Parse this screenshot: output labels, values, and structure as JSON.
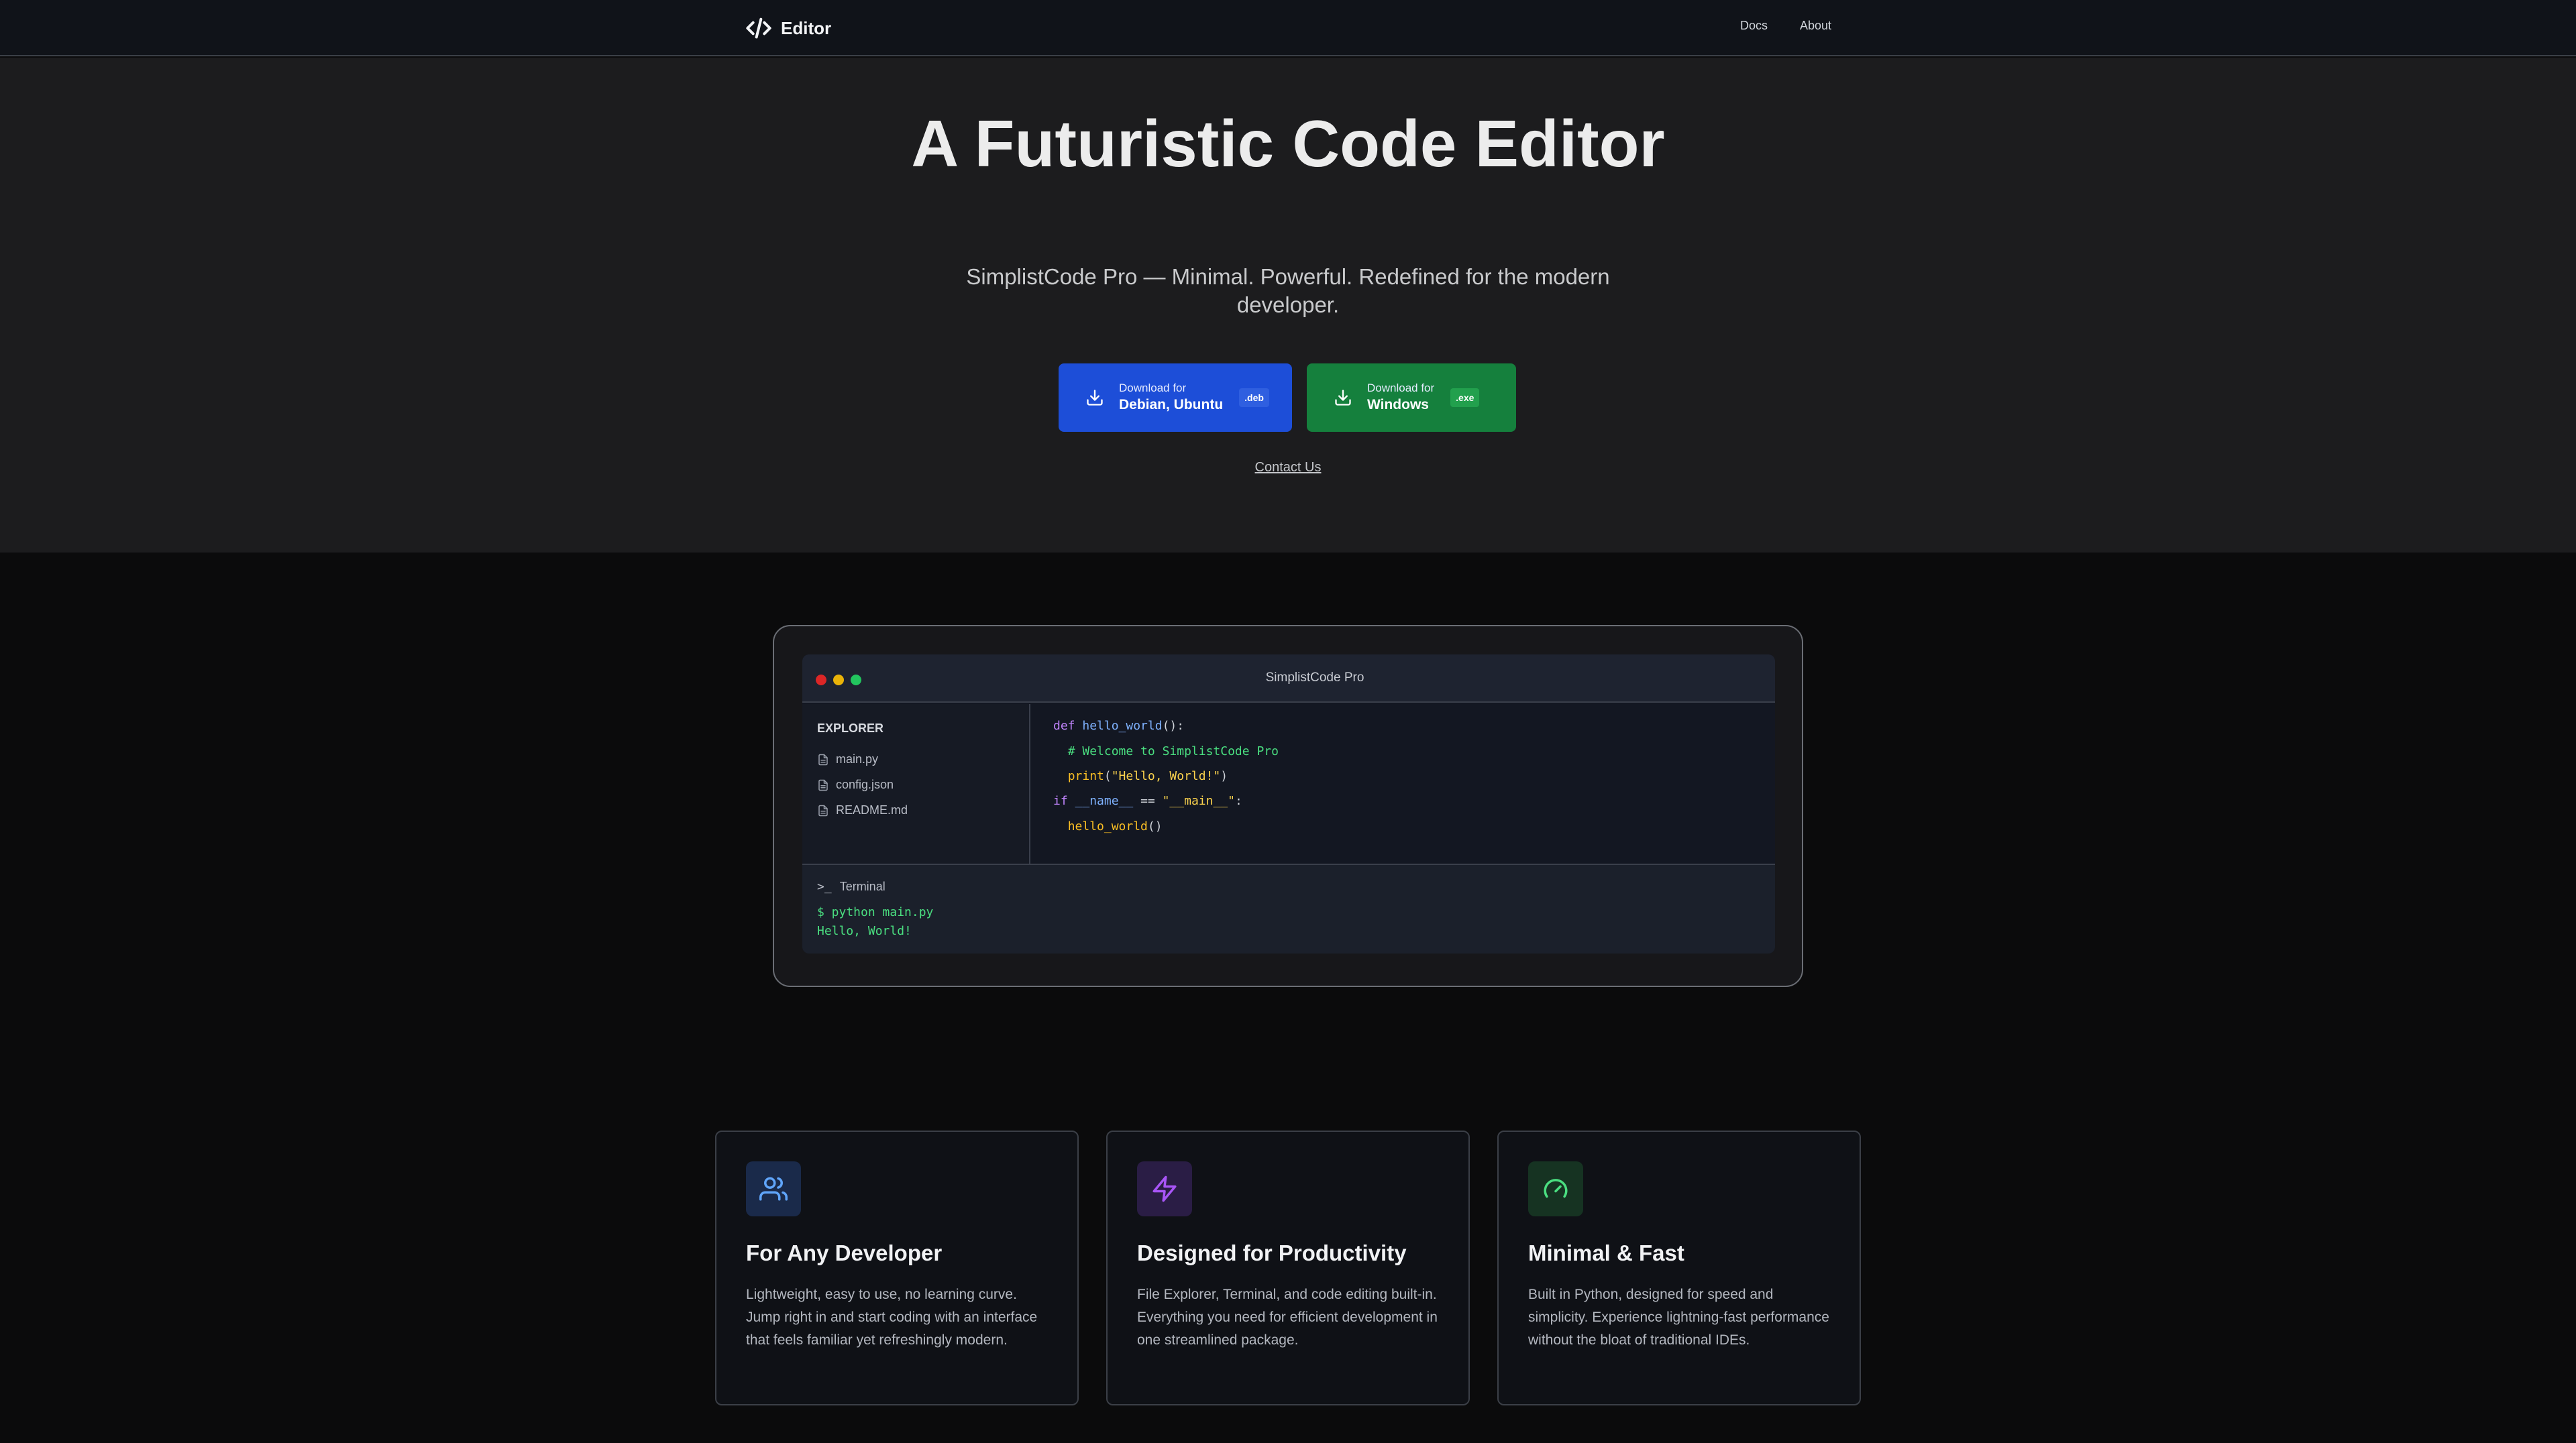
{
  "nav": {
    "brand": "Editor",
    "brand_icon": "code-brackets-icon",
    "links": [
      "Docs",
      "About"
    ]
  },
  "hero": {
    "title": "A Futuristic Code Editor",
    "subtitle": "SimplistCode Pro — Minimal. Powerful. Redefined for the modern developer.",
    "buttons": [
      {
        "small": "Download for",
        "big": "Debian, Ubuntu",
        "badge": ".deb",
        "icon": "download-icon",
        "color": "#1d4ed8"
      },
      {
        "small": "Download for",
        "big": "Windows",
        "badge": ".exe",
        "icon": "download-icon",
        "color": "#15803d"
      }
    ],
    "contact": "Contact Us"
  },
  "editor_mock": {
    "window_title": "SimplistCode Pro",
    "explorer_label": "EXPLORER",
    "files": [
      "main.py",
      "config.json",
      "README.md"
    ],
    "code_lines": [
      "def hello_world():",
      "  # Welcome to SimplistCode Pro",
      "  print(\"Hello, World!\")",
      "if __name__ == \"__main__\":",
      "  hello_world()"
    ],
    "terminal_label": "Terminal",
    "terminal_lines": [
      "$ python main.py",
      "Hello, World!"
    ]
  },
  "features": [
    {
      "icon": "users-icon",
      "title": "For Any Developer",
      "description": "Lightweight, easy to use, no learning curve. Jump right in and start coding with an interface that feels familiar yet refreshingly modern."
    },
    {
      "icon": "lightning-icon",
      "title": "Designed for Productivity",
      "description": "File Explorer, Terminal, and code editing built-in. Everything you need for efficient development in one streamlined package."
    },
    {
      "icon": "gauge-icon",
      "title": "Minimal & Fast",
      "description": "Built in Python, designed for speed and simplicity. Experience lightning-fast performance without the bloat of traditional IDEs."
    }
  ]
}
